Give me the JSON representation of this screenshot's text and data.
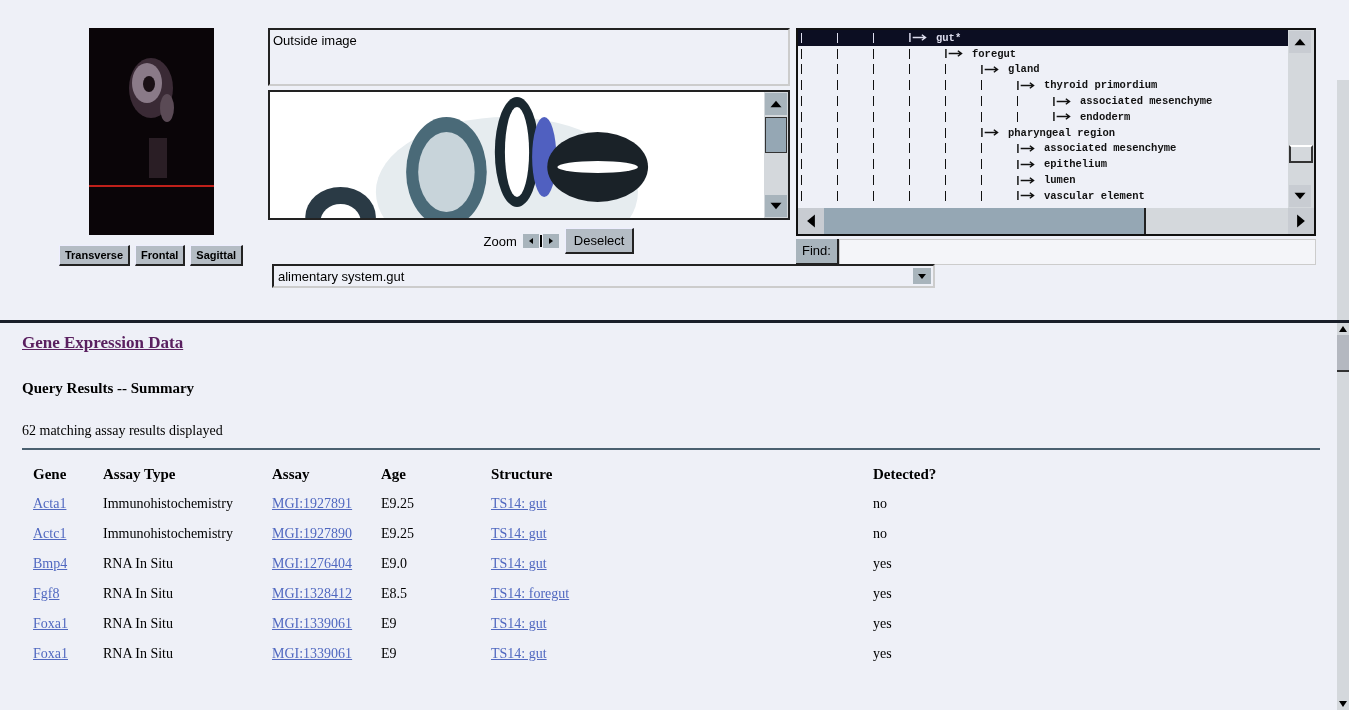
{
  "view_buttons": [
    {
      "label": "Transverse"
    },
    {
      "label": "Frontal"
    },
    {
      "label": "Sagittal"
    }
  ],
  "info_box": {
    "text": "Outside image"
  },
  "zoom": {
    "label": "Zoom",
    "button": "Deselect"
  },
  "structure_select": {
    "value": "alimentary system.gut"
  },
  "tree": [
    {
      "label": "gut*",
      "selected": true,
      "children": [
        {
          "label": "foregut",
          "selected": false,
          "children": [
            {
              "label": "gland",
              "selected": false,
              "children": [
                {
                  "label": "thyroid primordium",
                  "selected": false,
                  "children": [
                    {
                      "label": "associated mesenchyme",
                      "selected": false
                    },
                    {
                      "label": "endoderm",
                      "selected": false
                    }
                  ]
                }
              ]
            },
            {
              "label": "pharyngeal region",
              "selected": false,
              "children": [
                {
                  "label": "associated mesenchyme",
                  "selected": false
                },
                {
                  "label": "epithelium",
                  "selected": false
                },
                {
                  "label": "lumen",
                  "selected": false
                },
                {
                  "label": "vascular element",
                  "selected": false
                }
              ]
            }
          ]
        }
      ]
    }
  ],
  "find": {
    "label": "Find:"
  },
  "results": {
    "title": "Gene Expression Data",
    "subtitle": "Query Results -- Summary",
    "count": "62 matching assay results displayed",
    "columns": [
      "Gene",
      "Assay Type",
      "Assay",
      "Age",
      "Structure",
      "Detected?"
    ],
    "rows": [
      [
        "Acta1",
        "Immunohistochemistry",
        "MGI:1927891",
        "E9.25",
        "TS14: gut",
        "no"
      ],
      [
        "Actc1",
        "Immunohistochemistry",
        "MGI:1927890",
        "E9.25",
        "TS14: gut",
        "no"
      ],
      [
        "Bmp4",
        "RNA In Situ",
        "MGI:1276404",
        "E9.0",
        "TS14: gut",
        "yes"
      ],
      [
        "Fgf8",
        "RNA In Situ",
        "MGI:1328412",
        "E8.5",
        "TS14: foregut",
        "yes"
      ],
      [
        "Foxa1",
        "RNA In Situ",
        "MGI:1339061",
        "E9",
        "TS14: gut",
        "yes"
      ],
      [
        "Foxa1",
        "RNA In Situ",
        "MGI:1339061",
        "E9",
        "TS14: gut",
        "yes"
      ]
    ]
  }
}
